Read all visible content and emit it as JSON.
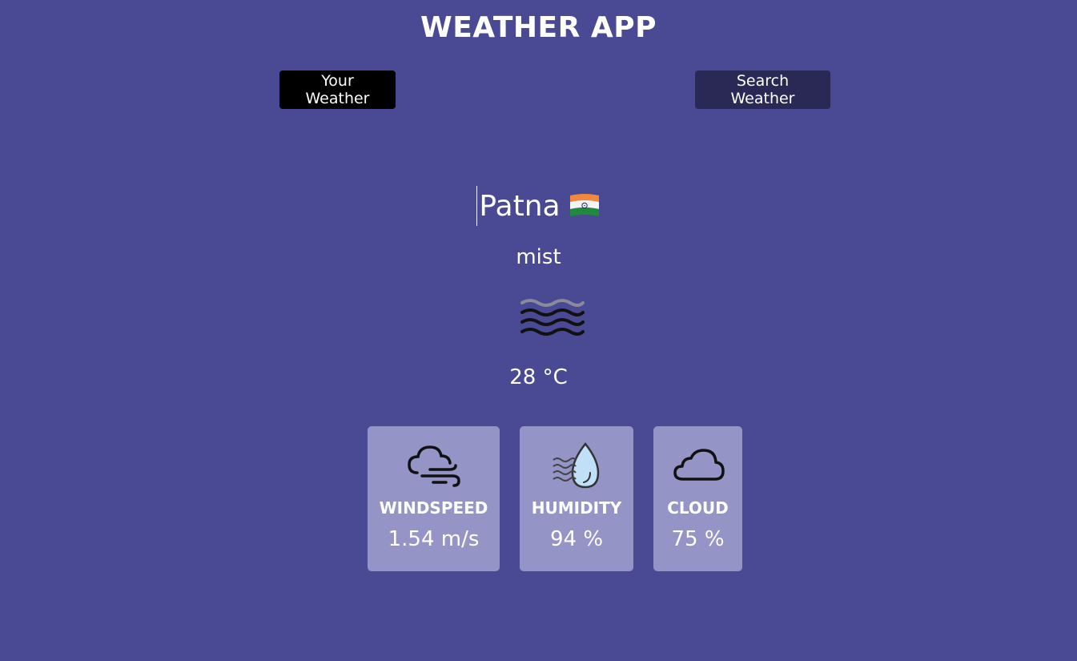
{
  "app": {
    "title": "WEATHER APP"
  },
  "tabs": {
    "your_weather": "Your Weather",
    "search_weather": "Search Weather"
  },
  "location": {
    "city": "Patna",
    "country_flag_icon": "india-flag-icon"
  },
  "current": {
    "description": "mist",
    "icon": "mist-icon",
    "temperature": "28 °C"
  },
  "stats": {
    "windspeed": {
      "label": "WINDSPEED",
      "value": "1.54 m/s",
      "icon": "wind-cloud-icon"
    },
    "humidity": {
      "label": "HUMIDITY",
      "value": "94 %",
      "icon": "water-drop-icon"
    },
    "cloud": {
      "label": "CLOUD",
      "value": "75 %",
      "icon": "cloud-icon"
    }
  },
  "colors": {
    "background": "#4a4994",
    "card": "#9594c6",
    "active_tab": "#000000",
    "inactive_tab": "#2a2956"
  }
}
